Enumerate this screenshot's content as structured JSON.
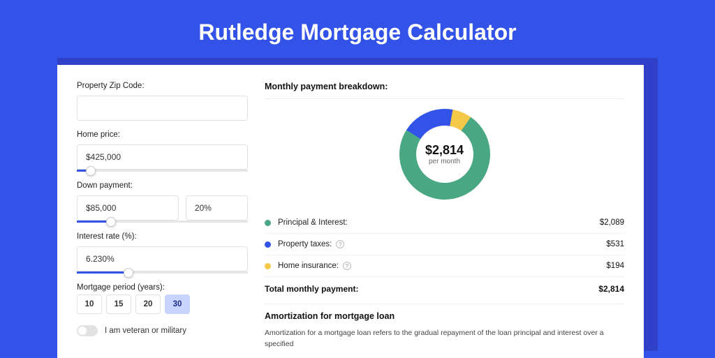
{
  "title": "Rutledge Mortgage Calculator",
  "colors": {
    "pi": "#4aa783",
    "tax": "#3353e8",
    "ins": "#f4c94a"
  },
  "form": {
    "zip": {
      "label": "Property Zip Code:",
      "value": ""
    },
    "price": {
      "label": "Home price:",
      "value": "$425,000",
      "slider_pct": 8
    },
    "down": {
      "label": "Down payment:",
      "value": "$85,000",
      "pct": "20%",
      "slider_pct": 20
    },
    "rate": {
      "label": "Interest rate (%):",
      "value": "6.230%",
      "slider_pct": 30
    },
    "period": {
      "label": "Mortgage period (years):",
      "options": [
        "10",
        "15",
        "20",
        "30"
      ],
      "selected": "30"
    },
    "veteran_label": "I am veteran or military"
  },
  "breakdown": {
    "header": "Monthly payment breakdown:",
    "center_amount": "$2,814",
    "center_sub": "per month",
    "items": [
      {
        "key": "pi",
        "label": "Principal & Interest:",
        "value": "$2,089",
        "info": false
      },
      {
        "key": "tax",
        "label": "Property taxes:",
        "value": "$531",
        "info": true
      },
      {
        "key": "ins",
        "label": "Home insurance:",
        "value": "$194",
        "info": true
      }
    ],
    "total_label": "Total monthly payment:",
    "total_value": "$2,814"
  },
  "amort": {
    "header": "Amortization for mortgage loan",
    "text": "Amortization for a mortgage loan refers to the gradual repayment of the loan principal and interest over a specified"
  },
  "chart_data": {
    "type": "pie",
    "title": "Monthly payment breakdown",
    "series": [
      {
        "name": "Principal & Interest",
        "value": 2089,
        "color": "#4aa783"
      },
      {
        "name": "Property taxes",
        "value": 531,
        "color": "#3353e8"
      },
      {
        "name": "Home insurance",
        "value": 194,
        "color": "#f4c94a"
      }
    ],
    "total": 2814,
    "center_label": "$2,814 per month"
  }
}
